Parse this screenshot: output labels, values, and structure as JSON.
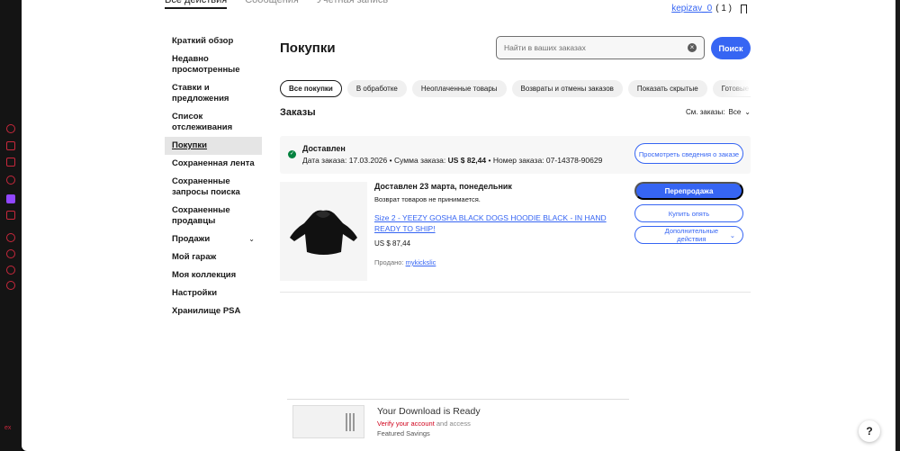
{
  "top_tabs": [
    "Все действия",
    "Сообщения",
    "Учетная запись"
  ],
  "user": {
    "name": "kepizav_0",
    "count": "( 1 )"
  },
  "sidebar": {
    "items": [
      "Краткий обзор",
      "Недавно просмотренные",
      "Ставки и предложения",
      "Список отслеживания",
      "Покупки",
      "Сохраненная лента",
      "Сохраненные запросы поиска",
      "Сохраненные продавцы",
      "Продажи",
      "Мой гараж",
      "Моя коллекция",
      "Настройки",
      "Хранилище PSA"
    ],
    "active": "Покупки"
  },
  "main": {
    "title": "Покупки",
    "search_placeholder": "Найти в ваших заказах",
    "search_button": "Поиск",
    "filters": [
      "Все покупки",
      "В обработке",
      "Неоплаченные товары",
      "Возвраты и отмены заказов",
      "Показать скрытые",
      "Готовые для отз"
    ],
    "orders_title": "Заказы",
    "sort_label": "См. заказы:",
    "sort_value": "Все"
  },
  "order": {
    "status": "Доставлен",
    "date_label": "Дата заказа:",
    "date": "17.03.2026",
    "sum_label": "Сумма заказа:",
    "sum": "US $ 82,44",
    "number_label": "Номер заказа:",
    "number": "07-14378-90629",
    "details_button": "Просмотреть сведения о заказе",
    "delivered_title": "Доставлен 23 марта, понедельник",
    "no_returns": "Возврат товаров не принимается.",
    "item_title": "Size 2 - YEEZY GOSHA BLACK DOGS HOODIE BLACK - IN HAND READY TO SHIP!",
    "price": "US $ 87,44",
    "seller_label": "Продано:",
    "seller": "mykickslic",
    "resell_button": "Перепродажа",
    "buy_again_button": "Купить опять",
    "more_actions_button": "Дополнительные действия"
  },
  "ad": {
    "title": "Your Download is Ready",
    "verify": "Verify your account",
    "verify_rest": "and access",
    "featured": "Featured Savings"
  },
  "help": "?",
  "rail_text": "ex",
  "colors": {
    "accent": "#3665f3",
    "success": "#05823f"
  }
}
